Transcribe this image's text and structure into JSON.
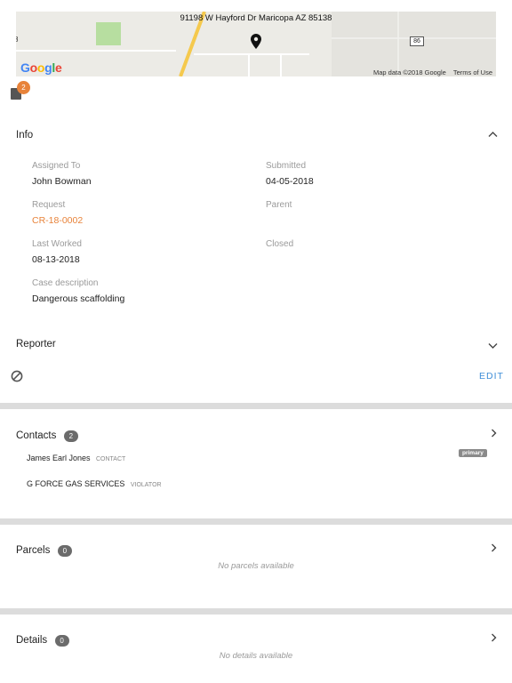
{
  "map": {
    "address": "91198 W Hayford Dr Maricopa AZ 85138",
    "logo_text": "Google",
    "map_data": "Map data ©2018 Google",
    "terms": "Terms of Use",
    "route_label": "86",
    "side_label": "8"
  },
  "attachments": {
    "count": "2"
  },
  "info": {
    "title": "Info",
    "fields": {
      "assigned_to": {
        "label": "Assigned To",
        "value": "John Bowman"
      },
      "submitted": {
        "label": "Submitted",
        "value": "04-05-2018"
      },
      "request": {
        "label": "Request",
        "value": "CR-18-0002"
      },
      "parent": {
        "label": "Parent",
        "value": ""
      },
      "last_worked": {
        "label": "Last Worked",
        "value": "08-13-2018"
      },
      "closed": {
        "label": "Closed",
        "value": ""
      },
      "case_description": {
        "label": "Case description",
        "value": "Dangerous scaffolding"
      }
    }
  },
  "reporter": {
    "title": "Reporter",
    "edit_label": "EDIT"
  },
  "contacts": {
    "title": "Contacts",
    "count": "2",
    "items": [
      {
        "name": "James Earl Jones",
        "role": "CONTACT",
        "tag": "primary"
      },
      {
        "name": "G FORCE GAS SERVICES",
        "role": "VIOLATOR",
        "tag": ""
      }
    ]
  },
  "parcels": {
    "title": "Parcels",
    "count": "0",
    "empty": "No parcels available"
  },
  "details": {
    "title": "Details",
    "count": "0",
    "empty": "No details available"
  },
  "colors": {
    "accent": "#e8833a",
    "link": "#3f8ed8",
    "divider": "#dcdcdc"
  }
}
